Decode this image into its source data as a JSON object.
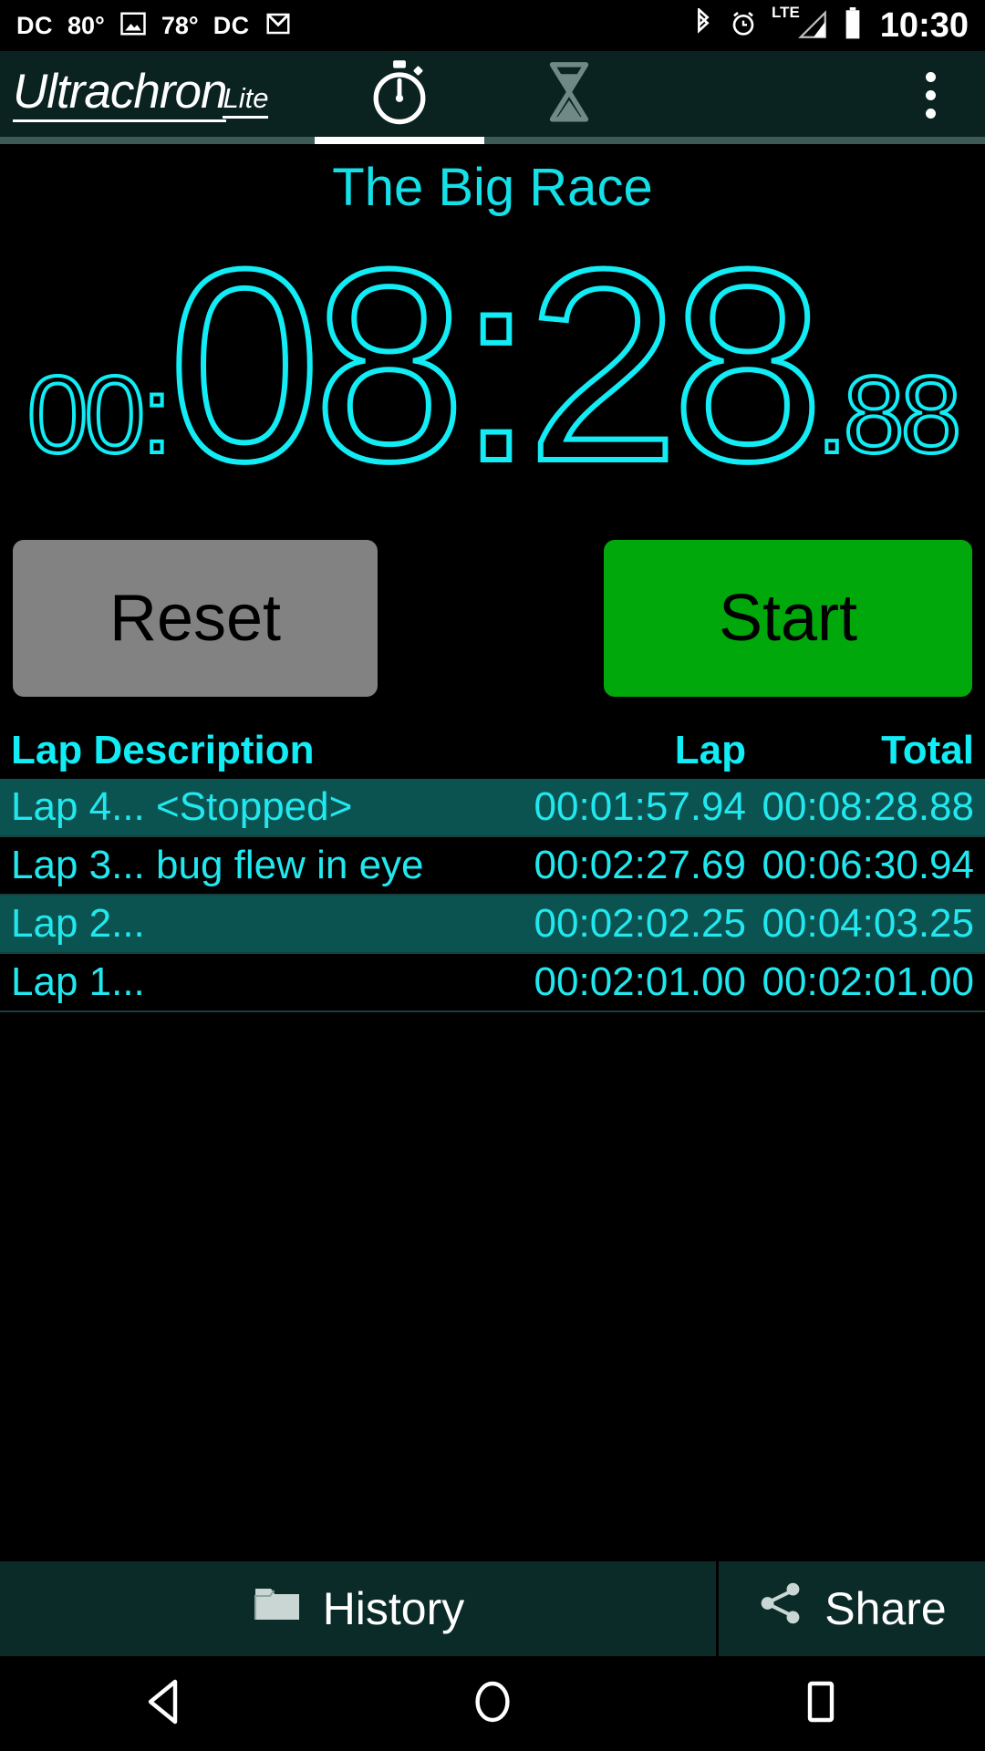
{
  "status_bar": {
    "left_items": [
      {
        "type": "text",
        "name": "dc-label-1",
        "value": "DC"
      },
      {
        "type": "text",
        "name": "temp-1",
        "value": "80°"
      },
      {
        "type": "icon",
        "name": "photo-icon",
        "value": "photo-icon"
      },
      {
        "type": "text",
        "name": "temp-2",
        "value": "78°"
      },
      {
        "type": "text",
        "name": "dc-label-2",
        "value": "DC"
      },
      {
        "type": "icon",
        "name": "gmail-icon",
        "value": "gmail-icon"
      }
    ],
    "right_icons": [
      "bluetooth-icon",
      "alarm-icon",
      "lte-signal-icon",
      "battery-icon"
    ],
    "lte_label": "LTE",
    "clock": "10:30"
  },
  "app_bar": {
    "brand_main": "Ultrachron",
    "brand_sub": "Lite",
    "tabs": [
      {
        "name": "tab-stopwatch",
        "icon": "stopwatch-icon",
        "active": true
      },
      {
        "name": "tab-timer",
        "icon": "hourglass-icon",
        "active": false
      }
    ],
    "overflow_icon": "more-vertical-icon",
    "background": "#0a2320"
  },
  "stopwatch": {
    "title": "The Big Race",
    "time": {
      "hours": "00:",
      "main": "08:28",
      "fraction": ".88"
    },
    "full_time": "00:08:28.88",
    "accent_color": "#12ecf5",
    "buttons": {
      "reset": {
        "label": "Reset",
        "color": "#828282"
      },
      "start": {
        "label": "Start",
        "color": "#00a80b"
      }
    }
  },
  "lap_table": {
    "headers": {
      "description": "Lap Description",
      "lap": "Lap",
      "total": "Total"
    },
    "rows": [
      {
        "description": "Lap 4... <Stopped>",
        "lap": "00:01:57.94",
        "total": "00:08:28.88",
        "highlighted": true
      },
      {
        "description": "Lap 3... bug flew in eye",
        "lap": "00:02:27.69",
        "total": "00:06:30.94",
        "highlighted": false
      },
      {
        "description": "Lap 2...",
        "lap": "00:02:02.25",
        "total": "00:04:03.25",
        "highlighted": true
      },
      {
        "description": "Lap 1...",
        "lap": "00:02:01.00",
        "total": "00:02:01.00",
        "highlighted": false
      }
    ]
  },
  "bottom_bar": {
    "history": {
      "label": "History",
      "icon": "folder-icon"
    },
    "share": {
      "label": "Share",
      "icon": "share-icon"
    }
  },
  "nav_bar": {
    "back": "back-triangle-icon",
    "home": "home-circle-icon",
    "recents": "recents-square-icon"
  }
}
